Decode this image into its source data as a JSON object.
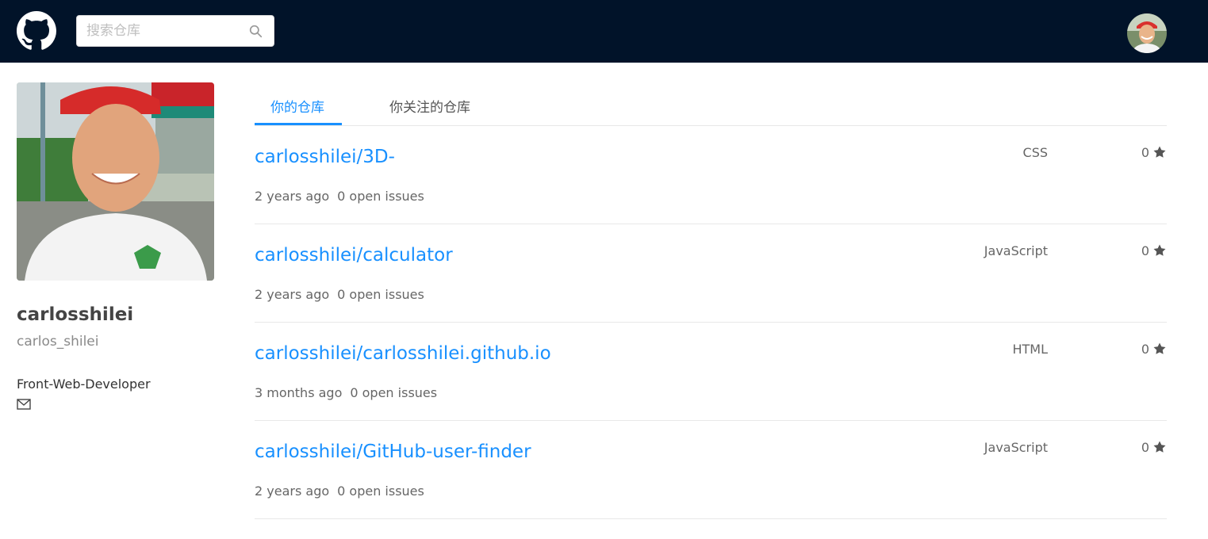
{
  "header": {
    "logo_icon": "github-icon",
    "search": {
      "placeholder": "搜索仓库",
      "value": ""
    },
    "search_icon": "search-icon",
    "avatar_icon": "user-avatar"
  },
  "profile": {
    "name": "carlosshilei",
    "login": "carlos_shilei",
    "bio": "Front-Web-Developer",
    "email_icon": "mail-icon"
  },
  "tabs": [
    {
      "label": "你的仓库",
      "active": true
    },
    {
      "label": "你关注的仓库",
      "active": false
    }
  ],
  "repos": [
    {
      "name": "carlosshilei/3D-",
      "updated": "2 years ago",
      "issues": "0 open issues",
      "language": "CSS",
      "stars": "0"
    },
    {
      "name": "carlosshilei/calculator",
      "updated": "2 years ago",
      "issues": "0 open issues",
      "language": "JavaScript",
      "stars": "0"
    },
    {
      "name": "carlosshilei/carlosshilei.github.io",
      "updated": "3 months ago",
      "issues": "0 open issues",
      "language": "HTML",
      "stars": "0"
    },
    {
      "name": "carlosshilei/GitHub-user-finder",
      "updated": "2 years ago",
      "issues": "0 open issues",
      "language": "JavaScript",
      "stars": "0"
    }
  ],
  "colors": {
    "header_bg": "#011329",
    "accent": "#1890ff"
  }
}
